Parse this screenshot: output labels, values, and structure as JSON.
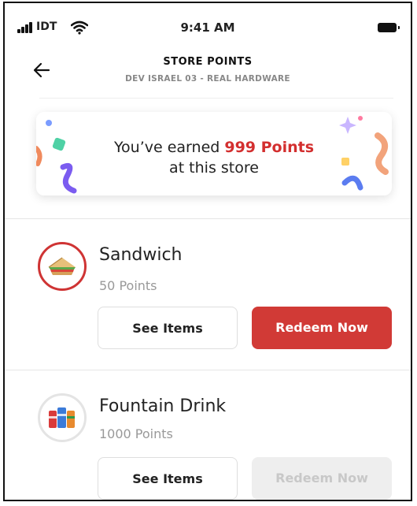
{
  "status_bar": {
    "carrier": "IDT",
    "time": "9:41 AM"
  },
  "header": {
    "title": "STORE POINTS",
    "subtitle": "DEV ISRAEL 03 - REAL HARDWARE"
  },
  "points_card": {
    "line1_prefix": "You’ve earned ",
    "points_text": "999 Points",
    "line2": "at this store",
    "accent_color": "#d32f2f"
  },
  "items": [
    {
      "name": "Sandwich",
      "points": "50 Points",
      "icon": "sandwich-icon",
      "see_label": "See Items",
      "redeem_label": "Redeem Now",
      "redeem_enabled": true
    },
    {
      "name": "Fountain Drink",
      "points": "1000 Points",
      "icon": "soda-cans-icon",
      "see_label": "See Items",
      "redeem_label": "Redeem Now",
      "redeem_enabled": false
    }
  ],
  "colors": {
    "primary": "#d13a36",
    "disabled_bg": "#eeeeee",
    "muted_text": "#999999"
  }
}
